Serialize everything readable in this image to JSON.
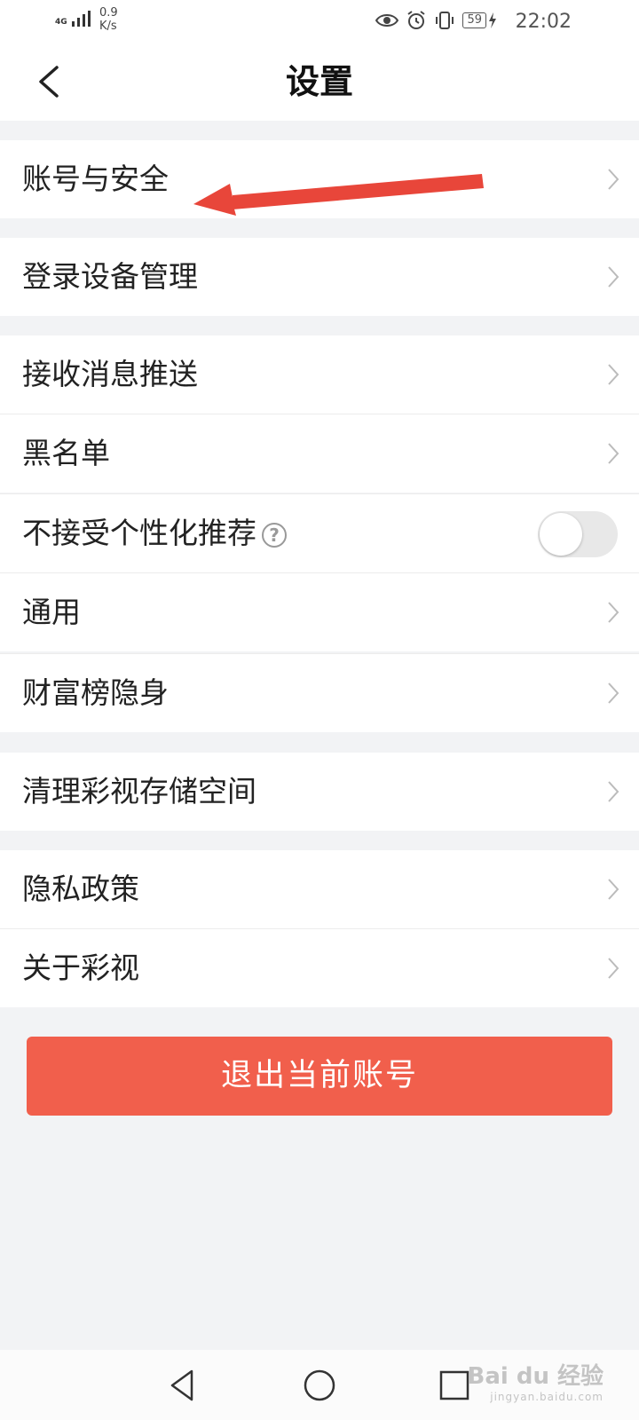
{
  "status_bar": {
    "network": "4G",
    "speed_value": "0.9",
    "speed_unit": "K/s",
    "battery": "59",
    "time": "22:02"
  },
  "header": {
    "title": "设置"
  },
  "settings": {
    "account_security": "账号与安全",
    "login_devices": "登录设备管理",
    "push_notifications": "接收消息推送",
    "blacklist": "黑名单",
    "no_personalized": "不接受个性化推荐",
    "no_personalized_enabled": false,
    "general": "通用",
    "wealth_rank_hidden": "财富榜隐身",
    "clear_storage": "清理彩视存储空间",
    "privacy_policy": "隐私政策",
    "about": "关于彩视"
  },
  "logout_label": "退出当前账号",
  "colors": {
    "logout_button": "#f15f4c",
    "annotation_arrow": "#e8463a",
    "background": "#f2f3f5"
  },
  "watermark": {
    "brand": "Bai du 经验",
    "url": "jingyan.baidu.com"
  }
}
